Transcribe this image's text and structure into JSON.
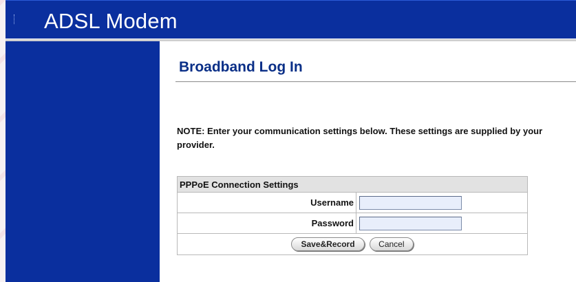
{
  "header": {
    "title": "ADSL Modem"
  },
  "page": {
    "title": "Broadband Log In",
    "note": "NOTE: Enter your communication settings below. These settings are supplied by your provider."
  },
  "settings": {
    "section_title": "PPPoE Connection Settings",
    "username_label": "Username",
    "username_value": "",
    "password_label": "Password",
    "password_value": ""
  },
  "buttons": {
    "save_label": "Save&Record",
    "cancel_label": "Cancel"
  },
  "colors": {
    "brand_blue": "#0a2f9e",
    "title_blue": "#0a2f87",
    "input_bg": "#e8eefb",
    "table_header_bg": "#e2e2e2"
  }
}
